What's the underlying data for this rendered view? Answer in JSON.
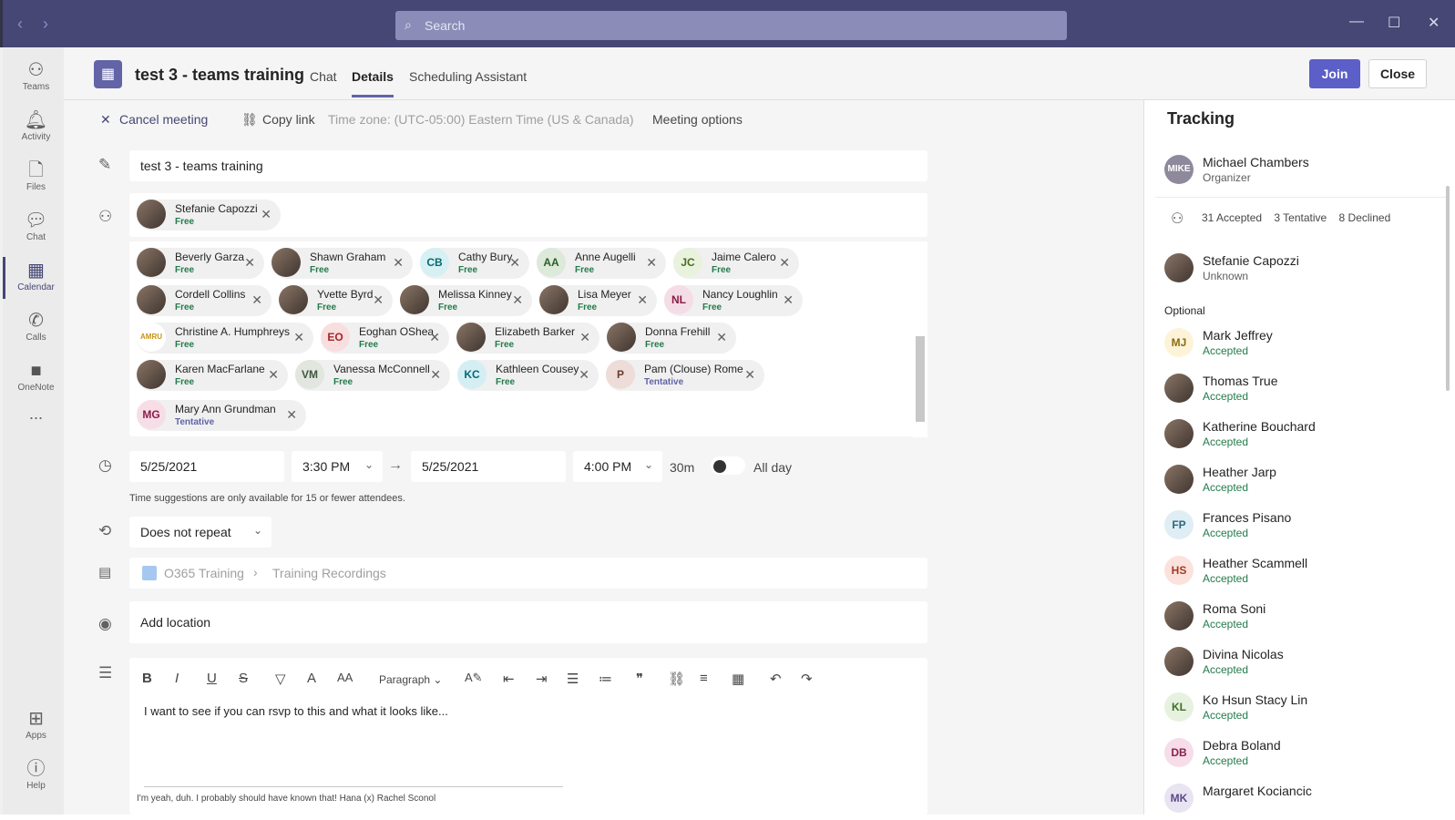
{
  "titlebar": {
    "search_placeholder": "Search",
    "back": "‹",
    "forward": "›",
    "minimize": "—",
    "maximize": "☐",
    "close": "✕"
  },
  "rail": [
    {
      "label": "Teams",
      "icon": "teams-icon"
    },
    {
      "label": "Activity",
      "icon": "bell-icon"
    },
    {
      "label": "Files",
      "icon": "file-icon"
    },
    {
      "label": "Chat",
      "icon": "chat-icon"
    },
    {
      "label": "Calendar",
      "icon": "calendar-icon"
    },
    {
      "label": "Calls",
      "icon": "phone-icon"
    },
    {
      "label": "OneNote",
      "icon": "onenote-icon"
    },
    {
      "label": "...",
      "icon": "more-icon"
    },
    {
      "label": "Apps",
      "icon": "apps-icon"
    },
    {
      "label": "Help",
      "icon": "help-icon"
    }
  ],
  "header": {
    "title": "test 3 - teams training",
    "tabs": [
      "Chat",
      "Details",
      "Scheduling Assistant"
    ],
    "join": "Join",
    "close": "Close"
  },
  "toolbar": {
    "cancel": "Cancel meeting",
    "copy": "Copy link",
    "timezone": "Time zone: (UTC-05:00) Eastern Time (US & Canada)",
    "options": "Meeting options"
  },
  "form": {
    "title_value": "test 3 - teams training",
    "required": {
      "name": "Stefanie Capozzi",
      "status": "Free"
    },
    "attendees": [
      {
        "initials": "",
        "name": "Beverly Garza",
        "status": "Free"
      },
      {
        "initials": "",
        "name": "Shawn Graham",
        "status": "Free"
      },
      {
        "initials": "CB",
        "name": "Cathy Bury",
        "status": "Free"
      },
      {
        "initials": "AA",
        "name": "Anne Augelli",
        "status": "Free"
      },
      {
        "initials": "JC",
        "name": "Jaime Calero",
        "status": "Free"
      },
      {
        "initials": "",
        "name": "Cordell Collins",
        "status": "Free"
      },
      {
        "initials": "",
        "name": "Yvette Byrd",
        "status": "Free"
      },
      {
        "initials": "",
        "name": "Melissa Kinney",
        "status": "Free"
      },
      {
        "initials": "",
        "name": "Lisa Meyer",
        "status": "Free"
      },
      {
        "initials": "NL",
        "name": "Nancy Loughlin",
        "status": "Free"
      },
      {
        "initials": "AMRU",
        "name": "Christine A. Humphreys",
        "status": "Free"
      },
      {
        "initials": "EO",
        "name": "Eoghan OShea",
        "status": "Free"
      },
      {
        "initials": "",
        "name": "Elizabeth Barker",
        "status": "Free"
      },
      {
        "initials": "",
        "name": "Donna Frehill",
        "status": "Free"
      },
      {
        "initials": "",
        "name": "Karen MacFarlane",
        "status": "Free"
      },
      {
        "initials": "VM",
        "name": "Vanessa McConnell",
        "status": "Free"
      },
      {
        "initials": "KC",
        "name": "Kathleen Cousey",
        "status": "Free"
      },
      {
        "initials": "P",
        "name": "Pam (Clouse) Rome",
        "status": "Tentative"
      },
      {
        "initials": "MG",
        "name": "Mary Ann Grundman",
        "status": "Tentative"
      }
    ],
    "start_date": "5/25/2021",
    "start_time": "3:30 PM",
    "end_date": "5/25/2021",
    "end_time": "4:00 PM",
    "duration": "30m",
    "allday": "All day",
    "suggestion_note": "Time suggestions are only available for 15 or fewer attendees.",
    "repeat": "Does not repeat",
    "channel": "O365 Training",
    "channel_sub": "Training Recordings",
    "location_placeholder": "Add location",
    "paragraph": "Paragraph",
    "body_text": "I want to see if you can rsvp to this and what it looks like...",
    "body_footer": "I'm yeah, duh. I probably should have known that! Hana (x) Rachel Sconol"
  },
  "tracking": {
    "title": "Tracking",
    "organizer": {
      "name": "Michael Chambers",
      "role": "Organizer",
      "initials": "MIKE"
    },
    "counts": "31 Accepted    3 Tentative    8 Declined",
    "required": {
      "name": "Stefanie Capozzi",
      "status": "Unknown"
    },
    "optional_label": "Optional",
    "optional": [
      {
        "initials": "MJ",
        "name": "Mark Jeffrey",
        "status": "Accepted"
      },
      {
        "initials": "",
        "name": "Thomas True",
        "status": "Accepted"
      },
      {
        "initials": "",
        "name": "Katherine Bouchard",
        "status": "Accepted"
      },
      {
        "initials": "",
        "name": "Heather Jarp",
        "status": "Accepted"
      },
      {
        "initials": "FP",
        "name": "Frances Pisano",
        "status": "Accepted"
      },
      {
        "initials": "HS",
        "name": "Heather Scammell",
        "status": "Accepted"
      },
      {
        "initials": "",
        "name": "Roma Soni",
        "status": "Accepted"
      },
      {
        "initials": "",
        "name": "Divina Nicolas",
        "status": "Accepted"
      },
      {
        "initials": "KL",
        "name": "Ko Hsun Stacy Lin",
        "status": "Accepted"
      },
      {
        "initials": "DB",
        "name": "Debra Boland",
        "status": "Accepted"
      },
      {
        "initials": "MK",
        "name": "Margaret Kociancic",
        "status": ""
      }
    ]
  }
}
